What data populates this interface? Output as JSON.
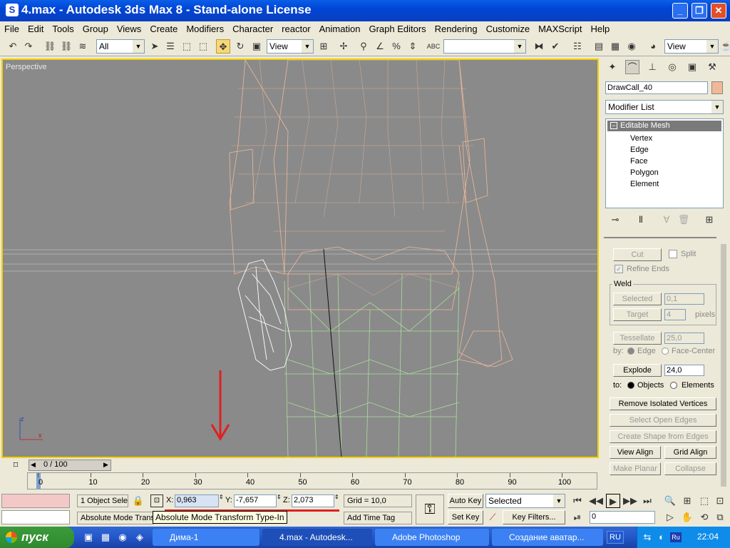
{
  "window": {
    "title": "4.max - Autodesk 3ds Max 8  - Stand-alone License",
    "icon": "3dsmax-app-icon"
  },
  "menubar": [
    "File",
    "Edit",
    "Tools",
    "Group",
    "Views",
    "Create",
    "Modifiers",
    "Character",
    "reactor",
    "Animation",
    "Graph Editors",
    "Rendering",
    "Customize",
    "MAXScript",
    "Help"
  ],
  "toolbar": {
    "selection_filter": "All",
    "ref_coord": "View",
    "ref_coord2": "View",
    "named_sel": ""
  },
  "viewport": {
    "label": "Perspective",
    "axis_x": "x",
    "axis_z": "z",
    "annotation_color": "#e02020",
    "border_color": "#f2d000",
    "mesh_peach": "#f0b898",
    "mesh_green": "#a8e09a"
  },
  "cmdpanel": {
    "object_name": "DrawCall_40",
    "object_color": "#f0b898",
    "modifier_list": "Modifier List",
    "stack": {
      "top": "Editable Mesh",
      "items": [
        "Vertex",
        "Edge",
        "Face",
        "Polygon",
        "Element"
      ]
    },
    "cut": "Cut",
    "split": "Split",
    "refine_ends": "Refine Ends",
    "weld": {
      "title": "Weld",
      "selected": "Selected",
      "selected_value": "0,1",
      "target": "Target",
      "target_value": "4",
      "pixels": "pixels"
    },
    "tessellate": "Tessellate",
    "tess_value": "25,0",
    "by": "by:",
    "edge": "Edge",
    "face_center": "Face-Center",
    "explode": "Explode",
    "explode_value": "24,0",
    "to": "to:",
    "objects": "Objects",
    "elements": "Elements",
    "remove_isolated": "Remove Isolated Vertices",
    "select_open_edges": "Select Open Edges",
    "create_shape": "Create Shape from Edges",
    "view_align": "View Align",
    "grid_align": "Grid Align",
    "make_planar": "Make Planar",
    "collapse": "Collapse"
  },
  "timeline": {
    "frame": "0 / 100",
    "ticks": [
      "0",
      "10",
      "20",
      "30",
      "40",
      "50",
      "60",
      "70",
      "80",
      "90",
      "100"
    ]
  },
  "status": {
    "selection": "1 Object Sele",
    "x_label": "X:",
    "x_value": "0,963",
    "y_label": "Y:",
    "y_value": "-7,657",
    "z_label": "Z:",
    "z_value": "2,073",
    "grid": "Grid = 10,0",
    "prompt": "Absolute Mode Trans",
    "tooltip": "Absolute Mode Transform Type-In",
    "add_time_tag": "Add Time Tag",
    "auto_key": "Auto Key",
    "set_key": "Set Key",
    "key_mode": "Selected",
    "key_filters": "Key Filters...",
    "current_frame": "0"
  },
  "taskbar": {
    "start": "пуск",
    "tasks": [
      {
        "label": "Дима-1",
        "active": false
      },
      {
        "label": "4.max - Autodesk...",
        "active": true
      },
      {
        "label": "Adobe Photoshop",
        "active": false
      },
      {
        "label": "Создание аватар...",
        "active": false
      }
    ],
    "lang": "RU",
    "tray_lang": "Ru",
    "clock": "22:04"
  }
}
